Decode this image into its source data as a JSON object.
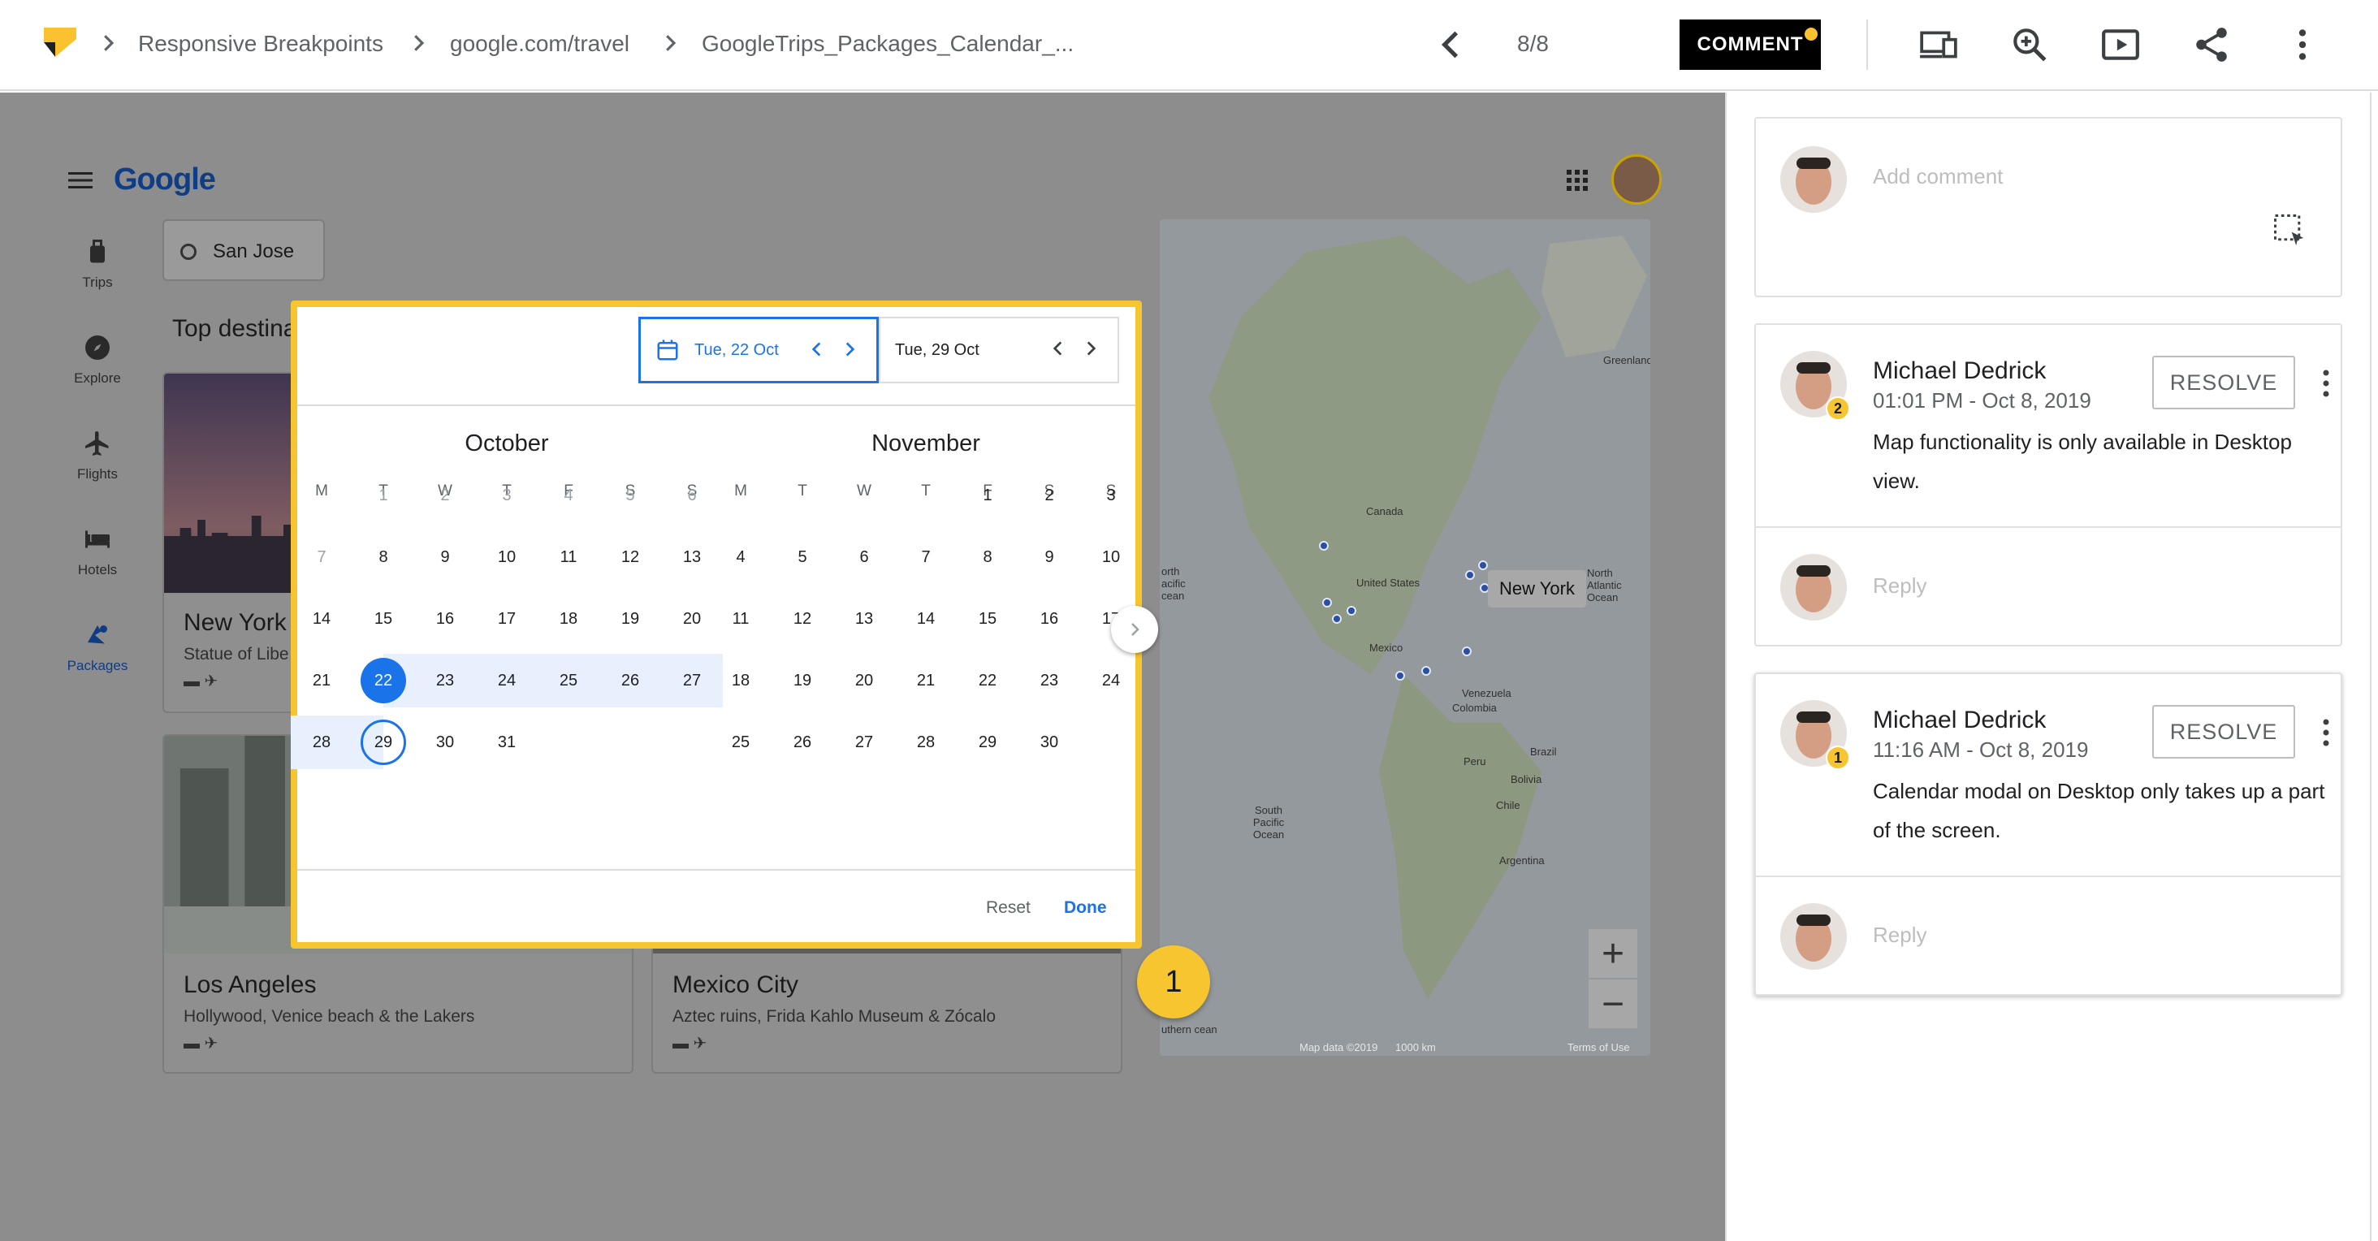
{
  "topbar": {
    "breadcrumbs": [
      "Responsive Breakpoints",
      "google.com/travel",
      "GoogleTrips_Packages_Calendar_..."
    ],
    "pager": "8/8",
    "comment_label": "COMMENT",
    "icons": [
      "back-icon",
      "devices-icon",
      "zoom-icon",
      "present-icon",
      "share-icon",
      "more-vert-icon"
    ]
  },
  "app": {
    "nav": [
      {
        "label": "Trips",
        "icon": "suitcase-icon"
      },
      {
        "label": "Explore",
        "icon": "compass-icon"
      },
      {
        "label": "Flights",
        "icon": "plane-icon"
      },
      {
        "label": "Hotels",
        "icon": "bed-icon"
      },
      {
        "label": "Packages",
        "icon": "package-icon"
      }
    ],
    "logo": "Google",
    "search_text": "San Jose",
    "section_title": "Top destina",
    "cards": [
      {
        "title": "New York",
        "subtitle": "Statue of Libe"
      },
      {
        "title": "Los Angeles",
        "subtitle": "Hollywood, Venice beach & the Lakers"
      },
      {
        "title": "Mexico City",
        "subtitle": "Aztec ruins, Frida Kahlo Museum & Zócalo"
      }
    ],
    "map": {
      "labels": [
        "Greenland",
        "Canada",
        "United States",
        "Mexico",
        "Venezuela",
        "Colombia",
        "Peru",
        "Brazil",
        "Bolivia",
        "Chile",
        "Argentina",
        "South Pacific Ocean",
        "North Atlantic Ocean",
        "orth acific cean",
        "uthern cean"
      ],
      "tooltip": "New York",
      "footer": [
        "Map data ©2019",
        "1000 km",
        "Terms of Use"
      ],
      "zoom_in": "+",
      "zoom_out": "−"
    }
  },
  "calendar": {
    "start_date": "Tue, 22 Oct",
    "end_date": "Tue, 29 Oct",
    "weekday_headers": [
      "M",
      "T",
      "W",
      "T",
      "F",
      "S",
      "S"
    ],
    "months": [
      {
        "name": "October",
        "offset": 1,
        "days": 31
      },
      {
        "name": "November",
        "offset": 4,
        "days": 30
      }
    ],
    "selected_start": 22,
    "selected_end": 29,
    "reset_label": "Reset",
    "done_label": "Done",
    "marker": "1"
  },
  "comments": {
    "add_placeholder": "Add comment",
    "reply_placeholder": "Reply",
    "resolve_label": "RESOLVE",
    "threads": [
      {
        "author": "Michael Dedrick",
        "time": "01:01 PM - Oct 8, 2019",
        "badge": "2",
        "text": "Map functionality is only available in Desktop view."
      },
      {
        "author": "Michael Dedrick",
        "time": "11:16 AM - Oct 8, 2019",
        "badge": "1",
        "text": "Calendar modal on Desktop only takes up a part of the screen."
      }
    ]
  },
  "colors": {
    "accent": "#1a73e8",
    "marker": "#f6c530",
    "overlay": "#8d8d8d"
  }
}
